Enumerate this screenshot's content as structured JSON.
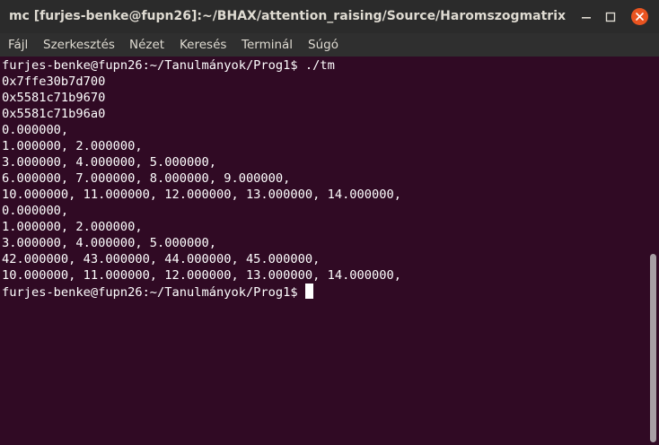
{
  "window": {
    "title": "mc [furjes-benke@fupn26]:~/BHAX/attention_raising/Source/Haromszogmatrix"
  },
  "menu": [
    "Fájl",
    "Szerkesztés",
    "Nézet",
    "Keresés",
    "Terminál",
    "Súgó"
  ],
  "terminal": {
    "lines": [
      "furjes-benke@fupn26:~/Tanulmányok/Prog1$ ./tm",
      "0x7ffe30b7d700",
      "0x5581c71b9670",
      "0x5581c71b96a0",
      "0.000000,",
      "1.000000, 2.000000,",
      "3.000000, 4.000000, 5.000000,",
      "6.000000, 7.000000, 8.000000, 9.000000,",
      "10.000000, 11.000000, 12.000000, 13.000000, 14.000000,",
      "0.000000,",
      "1.000000, 2.000000,",
      "3.000000, 4.000000, 5.000000,",
      "42.000000, 43.000000, 44.000000, 45.000000,",
      "10.000000, 11.000000, 12.000000, 13.000000, 14.000000,"
    ],
    "prompt": "furjes-benke@fupn26:~/Tanulmányok/Prog1$ "
  },
  "icons": {
    "minimize": "minimize-icon",
    "maximize": "maximize-icon",
    "close": "close-icon"
  },
  "colors": {
    "terminal_bg": "#300a24",
    "titlebar_bg": "#2b2b2b",
    "menubar_bg": "#2f2f2f",
    "close_button": "#e95420",
    "text": "#ffffff"
  }
}
